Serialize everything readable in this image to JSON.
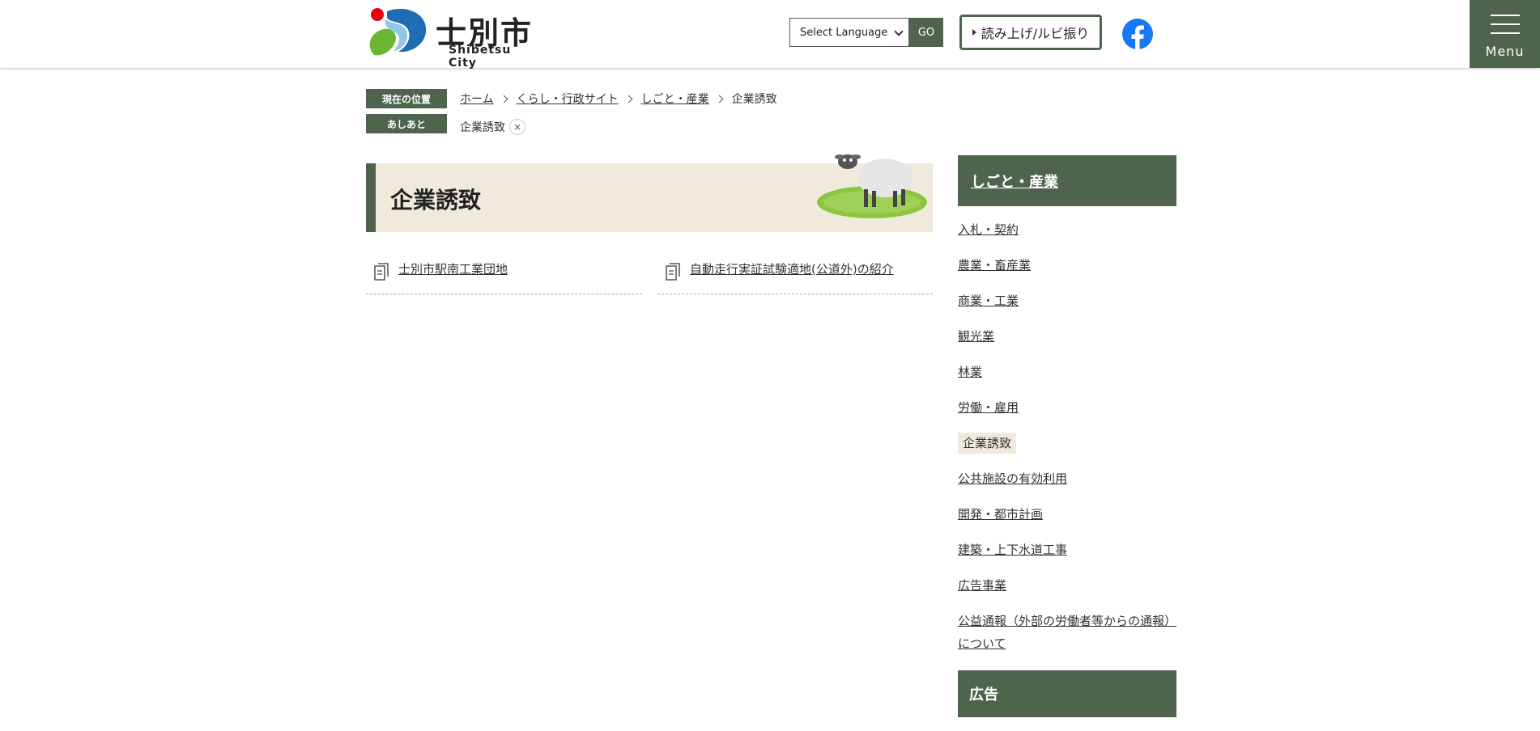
{
  "header": {
    "logo_jp": "士別市",
    "logo_en": "Shibetsu City",
    "language_select": "Select Language",
    "go_button": "GO",
    "read_aloud_button": "読み上げ/ルビ振り",
    "menu_label": "Menu"
  },
  "breadcrumb": {
    "current_tag": "現在の位置",
    "items": [
      "ホーム",
      "くらし・行政サイト",
      "しごと・産業"
    ],
    "current": "企業誘致",
    "history_tag": "あしあと",
    "history_item": "企業誘致",
    "history_close": "×"
  },
  "page": {
    "title": "企業誘致",
    "links": [
      "士別市駅南工業団地",
      "自動走行実証試験適地(公道外)の紹介"
    ]
  },
  "sidebar": {
    "heading": "しごと・産業",
    "items": [
      "入札・契約",
      "農業・畜産業",
      "商業・工業",
      "観光業",
      "林業",
      "労働・雇用",
      "企業誘致",
      "公共施設の有効利用",
      "開発・都市計画",
      "建築・上下水道工事",
      "広告事業",
      "公益通報（外部の労働者等からの通報）について"
    ],
    "active_index": 6,
    "ad_heading": "広告"
  },
  "colors": {
    "accent": "#4f644d",
    "beige": "#f0eadc",
    "facebook": "#1877f2"
  }
}
